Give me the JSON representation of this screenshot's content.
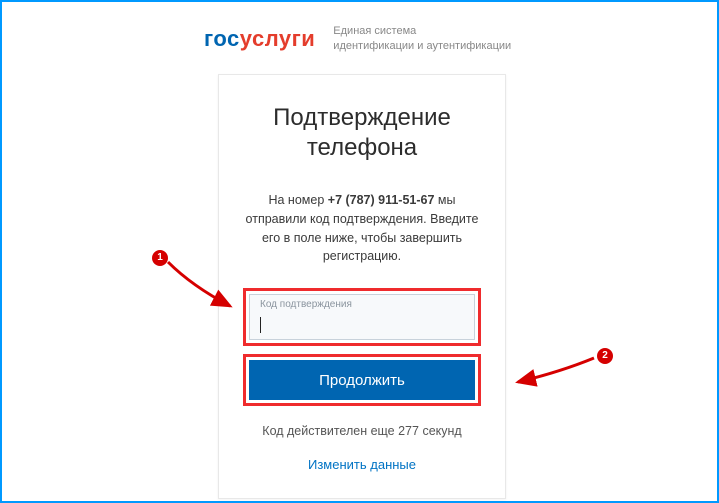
{
  "header": {
    "logo_gos": "гос",
    "logo_uslugi": "услуги",
    "subtitle_line1": "Единая система",
    "subtitle_line2": "идентификации и аутентификации"
  },
  "card": {
    "title_line1": "Подтверждение",
    "title_line2": "телефона",
    "instruction_prefix": "На номер ",
    "instruction_phone": "+7 (787) 911-51-67",
    "instruction_suffix": " мы отправили код подтверждения. Введите его в поле ниже, чтобы завершить регистрацию.",
    "field_label": "Код подтверждения",
    "field_value": "",
    "button_label": "Продолжить",
    "status_prefix": "Код действителен еще ",
    "status_seconds": "277",
    "status_suffix": " секунд",
    "link_label": "Изменить данные"
  },
  "annotations": {
    "badge1": "1",
    "badge2": "2"
  }
}
